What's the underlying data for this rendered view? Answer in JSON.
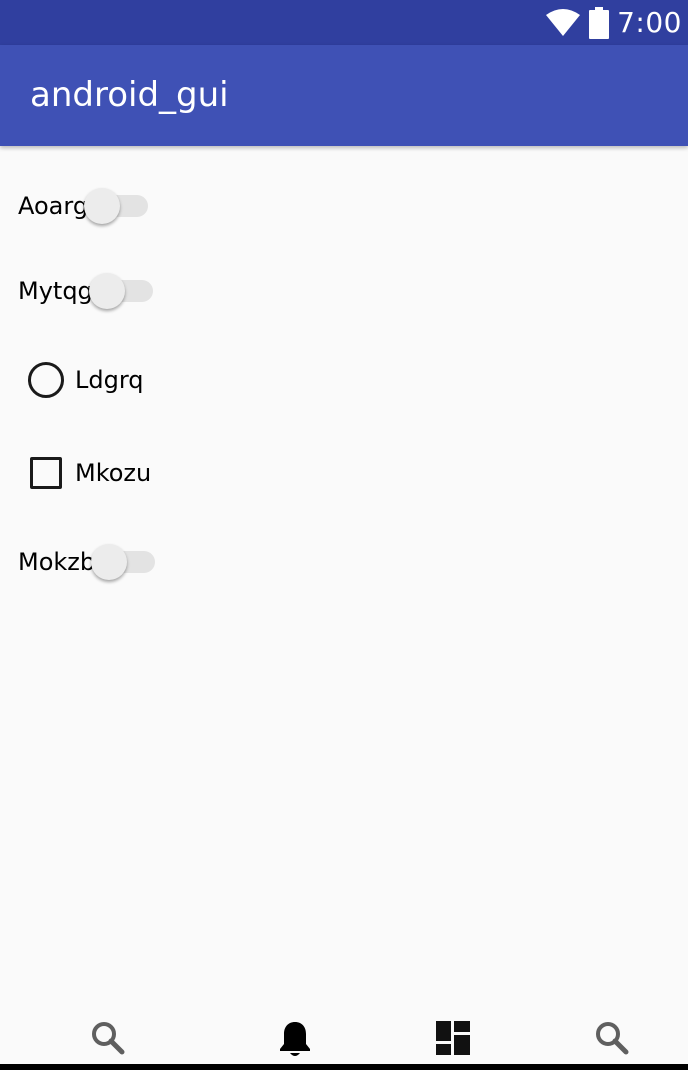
{
  "status_bar": {
    "time": "7:00",
    "icons": [
      "wifi-icon",
      "battery-icon"
    ],
    "background": "#303f9f"
  },
  "app_bar": {
    "title": "android_gui",
    "background": "#3f51b5"
  },
  "controls": {
    "switch_1": {
      "label": "Aoarg",
      "checked": false
    },
    "switch_2": {
      "label": "Mytqg",
      "checked": false
    },
    "radio_1": {
      "label": "Ldgrq",
      "checked": false
    },
    "checkbox_1": {
      "label": "Mkozu",
      "checked": false
    },
    "switch_3": {
      "label": "Mokzb",
      "checked": false
    }
  },
  "bottom_nav": {
    "items": [
      {
        "icon": "search-icon"
      },
      {
        "icon": "bell-icon"
      },
      {
        "icon": "dashboard-icon"
      },
      {
        "icon": "search-icon"
      }
    ]
  }
}
